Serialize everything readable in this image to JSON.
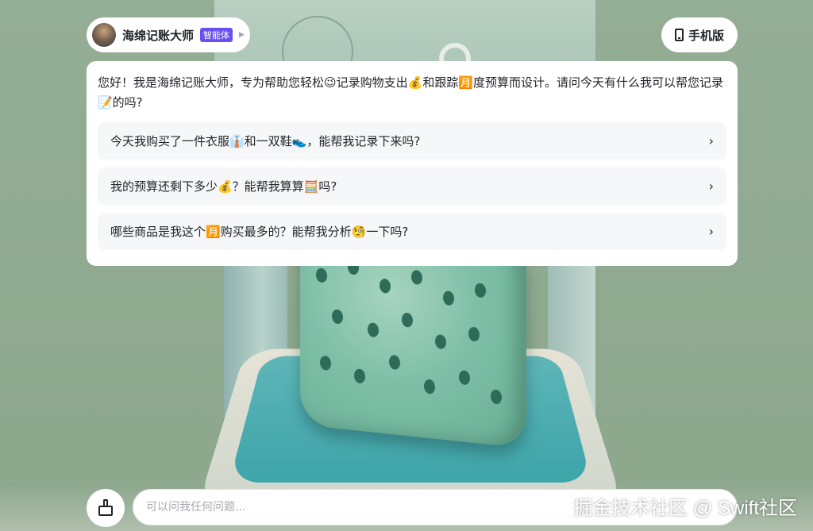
{
  "header": {
    "agent_name": "海绵记账大师",
    "agent_badge": "智能体",
    "mobile_label": "手机版"
  },
  "welcome": {
    "intro": "您好！我是海绵记账大师，专为帮助您轻松😉记录购物支出💰和跟踪🈷️度预算而设计。请问今天有什么我可以帮您记录📝的吗?",
    "suggestions": [
      {
        "label": "今天我购买了一件衣服👔和一双鞋👟，能帮我记录下来吗?"
      },
      {
        "label": "我的预算还剩下多少💰？能帮我算算🧮吗?"
      },
      {
        "label": "哪些商品是我这个🈷️购买最多的？能帮我分析🧐一下吗?"
      }
    ]
  },
  "input": {
    "placeholder": "可以问我任何问题..."
  },
  "watermark": "掘金技术社区 @ Swift社区",
  "colors": {
    "background": "#8faa8f",
    "badge": "#6a4ff0",
    "card": "#ffffff"
  },
  "icons": {
    "agent": "avatar",
    "mobile": "phone-icon",
    "clear": "broom-icon",
    "suggestion_arrow": "chevron-right-icon"
  }
}
